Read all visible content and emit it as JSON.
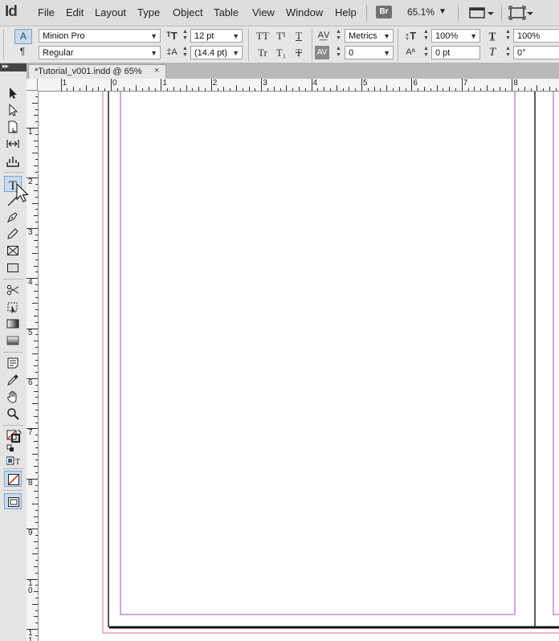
{
  "app": {
    "logo": "Id"
  },
  "menubar": {
    "items": [
      "File",
      "Edit",
      "Layout",
      "Type",
      "Object",
      "Table",
      "View",
      "Window",
      "Help"
    ],
    "bridge": "Br",
    "zoom": "65.1%"
  },
  "control_panel": {
    "font_family": "Minion Pro",
    "font_style": "Regular",
    "font_size": "12 pt",
    "leading": "(14.4 pt)",
    "kerning": "Metrics",
    "tracking": "0",
    "vertical_scale": "100%",
    "baseline_shift": "0 pt",
    "horizontal_scale": "100%",
    "skew": "0°"
  },
  "document": {
    "tab_title": "*Tutorial_v001.indd @ 65%",
    "close_glyph": "×"
  },
  "rulers": {
    "horizontal": [
      "1",
      "0",
      "1",
      "2",
      "3",
      "4",
      "5",
      "6",
      "7",
      "8"
    ],
    "vertical": [
      "1",
      "2",
      "3",
      "4",
      "5",
      "6",
      "7",
      "8",
      "9",
      "10",
      "11"
    ]
  },
  "colors": {
    "margin_guide": "#a349c7",
    "bleed_guide": "#e06a92",
    "active_tool": "#c9dbef"
  },
  "tools": [
    "selection-tool",
    "direct-selection-tool",
    "page-tool",
    "gap-tool",
    "content-collector-tool",
    "type-tool",
    "line-tool",
    "pen-tool",
    "pencil-tool",
    "rectangle-frame-tool",
    "rectangle-tool",
    "scissors-tool",
    "free-transform-tool",
    "gradient-swatch-tool",
    "gradient-feather-tool",
    "note-tool",
    "eyedropper-tool",
    "hand-tool",
    "zoom-tool",
    "fill-stroke-swatch",
    "formatting-affects-container",
    "apply-none",
    "screen-mode"
  ]
}
